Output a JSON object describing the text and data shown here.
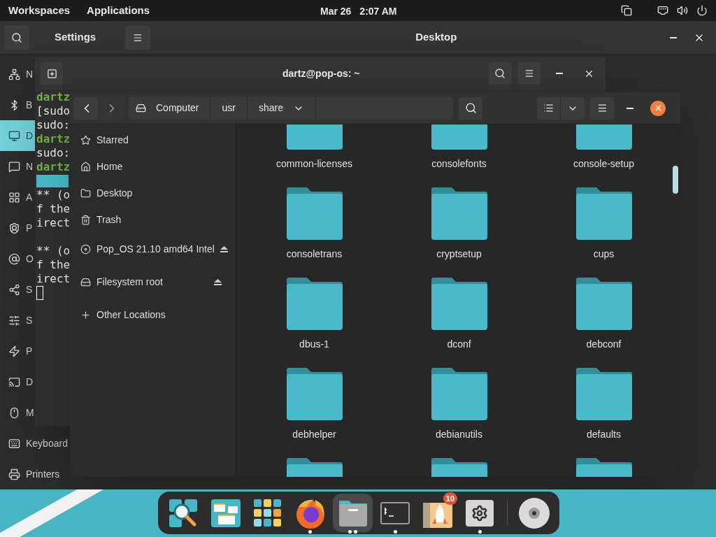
{
  "top_bar": {
    "menus": [
      "Workspaces",
      "Applications"
    ],
    "date": "Mar 26",
    "time": "2:07 AM"
  },
  "settings": {
    "title": "Settings",
    "panel_title": "Desktop",
    "sidebar": [
      {
        "kind": "network",
        "label": "N",
        "selected": false
      },
      {
        "kind": "bluetooth",
        "label": "B",
        "selected": false
      },
      {
        "kind": "desktop",
        "label": "D",
        "selected": true
      },
      {
        "kind": "notifications",
        "label": "N",
        "selected": false
      },
      {
        "kind": "applications",
        "label": "A",
        "selected": false
      },
      {
        "kind": "privacy",
        "label": "P",
        "selected": false
      },
      {
        "kind": "accounts",
        "label": "O",
        "selected": false
      },
      {
        "kind": "sharing",
        "label": "S",
        "selected": false
      },
      {
        "kind": "sound",
        "label": "S",
        "selected": false
      },
      {
        "kind": "power",
        "label": "P",
        "selected": false
      },
      {
        "kind": "displays",
        "label": "D",
        "selected": false
      },
      {
        "kind": "mouse",
        "label": "M",
        "selected": false
      },
      {
        "kind": "keyboard",
        "label": "Keyboard",
        "selected": false
      },
      {
        "kind": "printers",
        "label": "Printers",
        "selected": false
      }
    ]
  },
  "terminal": {
    "title": "dartz@pop-os: ~",
    "lines": [
      {
        "kind": "prompt",
        "text": "dartz"
      },
      {
        "kind": "output",
        "text": "[sudo"
      },
      {
        "kind": "output",
        "text": "sudo:"
      },
      {
        "kind": "prompt",
        "text": "dartz"
      },
      {
        "kind": "output",
        "text": "sudo:"
      },
      {
        "kind": "prompt",
        "text": "dartz"
      },
      {
        "kind": "highlight"
      },
      {
        "kind": "output",
        "text": "** (o"
      },
      {
        "kind": "output",
        "text": "f the"
      },
      {
        "kind": "output",
        "text": "irect"
      },
      {
        "kind": "blank"
      },
      {
        "kind": "output",
        "text": "** (o"
      },
      {
        "kind": "output",
        "text": "f the"
      },
      {
        "kind": "output",
        "text": "irect"
      },
      {
        "kind": "cursor"
      }
    ]
  },
  "files": {
    "path": [
      {
        "kind": "root",
        "label": "Computer"
      },
      {
        "kind": "dir",
        "label": "usr"
      },
      {
        "kind": "current",
        "label": "share"
      }
    ],
    "sidebar": [
      {
        "kind": "starred",
        "label": "Starred",
        "eject": false
      },
      {
        "kind": "home",
        "label": "Home",
        "eject": false
      },
      {
        "kind": "desktop",
        "label": "Desktop",
        "eject": false
      },
      {
        "kind": "trash",
        "label": "Trash",
        "eject": false
      },
      {
        "kind": "disc",
        "label": "Pop_OS 21.10 amd64 Intel",
        "eject": true
      },
      {
        "kind": "drive",
        "label": "Filesystem root",
        "eject": true
      },
      {
        "kind": "other",
        "label": "Other Locations",
        "eject": false
      }
    ],
    "folders": [
      {
        "kind": "named",
        "name": "common-licenses"
      },
      {
        "kind": "named",
        "name": "consolefonts"
      },
      {
        "kind": "named",
        "name": "console-setup"
      },
      {
        "kind": "named",
        "name": "consoletrans"
      },
      {
        "kind": "named",
        "name": "cryptsetup"
      },
      {
        "kind": "named",
        "name": "cups"
      },
      {
        "kind": "named",
        "name": "dbus-1"
      },
      {
        "kind": "named",
        "name": "dconf"
      },
      {
        "kind": "named",
        "name": "debconf"
      },
      {
        "kind": "named",
        "name": "debhelper"
      },
      {
        "kind": "named",
        "name": "debianutils"
      },
      {
        "kind": "named",
        "name": "defaults"
      },
      {
        "kind": "unnamed"
      },
      {
        "kind": "unnamed"
      },
      {
        "kind": "unnamed"
      }
    ]
  },
  "dock": [
    {
      "kind": "search",
      "running": false,
      "several_windows": false
    },
    {
      "kind": "workspaces",
      "running": false,
      "several_windows": false
    },
    {
      "kind": "applications",
      "running": false,
      "several_windows": false
    },
    {
      "kind": "browser",
      "running": true,
      "several_windows": false
    },
    {
      "kind": "files",
      "running": true,
      "several_windows": true,
      "focused": true
    },
    {
      "kind": "terminal",
      "running": true,
      "several_windows": false
    },
    {
      "kind": "store",
      "running": false,
      "several_windows": false,
      "badge": "10"
    },
    {
      "kind": "settings",
      "running": true,
      "several_windows": false
    },
    {
      "kind": "disc",
      "running": false,
      "several_windows": false
    }
  ]
}
